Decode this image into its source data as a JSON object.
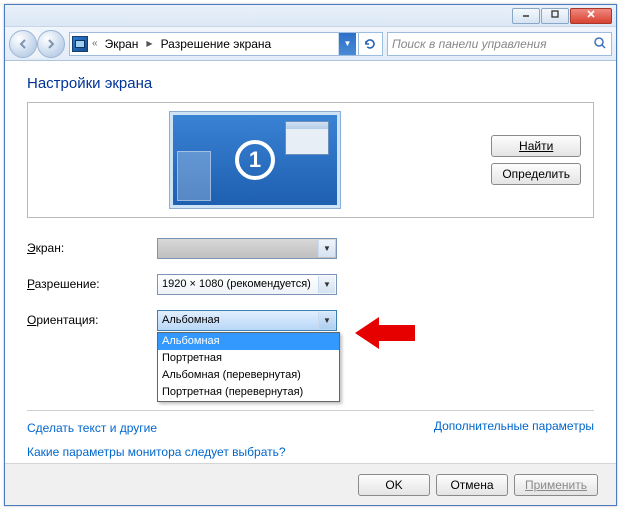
{
  "titlebar": {
    "minimize": "─",
    "maximize": "☐",
    "close": "✕"
  },
  "breadcrumb": {
    "sep": "«",
    "item1": "Экран",
    "item2": "Разрешение экрана",
    "arrow": "▶"
  },
  "search": {
    "placeholder": "Поиск в панели управления"
  },
  "page_title": "Настройки экрана",
  "monitor_number": "1",
  "buttons": {
    "find": "Найти",
    "detect": "Определить",
    "ok": "OK",
    "cancel": "Отмена",
    "apply": "Применить"
  },
  "labels": {
    "screen_pre": "Э",
    "screen_post": "кран:",
    "resolution_pre": "Р",
    "resolution_post": "азрешение:",
    "orientation_pre": "О",
    "orientation_post": "риентация:"
  },
  "resolution_value": "1920 × 1080 (рекомендуется)",
  "orientation": {
    "selected": "Альбомная",
    "options": [
      "Альбомная",
      "Портретная",
      "Альбомная (перевернутая)",
      "Портретная (перевернутая)"
    ]
  },
  "links": {
    "advanced": "Дополнительные параметры",
    "text_size": "Сделать текст и другие",
    "help": "Какие параметры монитора следует выбрать?"
  }
}
